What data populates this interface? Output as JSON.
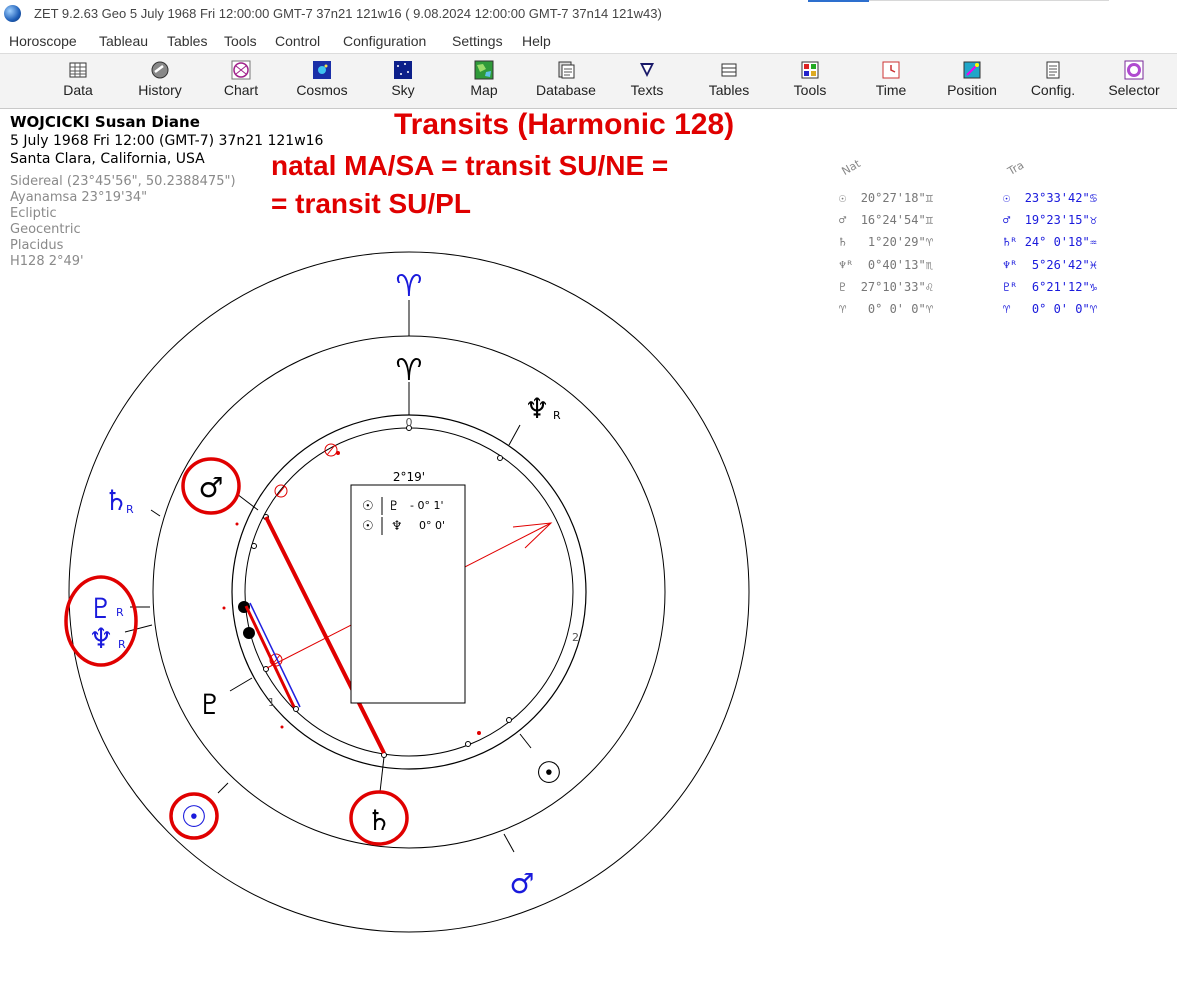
{
  "window": {
    "title": "ZET 9.2.63 Geo     5 July 1968  Fri  12:00:00 GMT-7 37n21  121w16  ( 9.08.2024  12:00:00 GMT-7 37n14 121w43)"
  },
  "menu": [
    "Horoscope",
    "Tableau",
    "Tables",
    "Tools",
    "Control",
    "Configuration",
    "Settings",
    "Help"
  ],
  "toolbar": [
    {
      "label": "Data",
      "icon": "data-grid-icon"
    },
    {
      "label": "History",
      "icon": "history-icon"
    },
    {
      "label": "Chart",
      "icon": "chart-wheel-icon"
    },
    {
      "label": "Cosmos",
      "icon": "cosmos-icon"
    },
    {
      "label": "Sky",
      "icon": "sky-icon"
    },
    {
      "label": "Map",
      "icon": "map-icon"
    },
    {
      "label": "Database",
      "icon": "database-icon"
    },
    {
      "label": "Texts",
      "icon": "texts-icon"
    },
    {
      "label": "Tables",
      "icon": "tables-icon"
    },
    {
      "label": "Tools",
      "icon": "tools-icon"
    },
    {
      "label": "Time",
      "icon": "time-icon"
    },
    {
      "label": "Position",
      "icon": "position-icon"
    },
    {
      "label": "Config.",
      "icon": "config-icon"
    },
    {
      "label": "Selector",
      "icon": "selector-icon"
    }
  ],
  "person": {
    "name": "WOJCICKI Susan Diane",
    "datetime": "5 July 1968  Fri  12:00 (GMT-7) 37n21  121w16",
    "place": "Santa Clara, California, USA",
    "settings": [
      "Sidereal (23°45'56\", 50.2388475\")",
      "Ayanamsa 23°19'34\"",
      "Ecliptic",
      "Geocentric",
      "Placidus",
      "H128   2°49'"
    ]
  },
  "annotation": {
    "title": "Transits (Harmonic 128)",
    "line1": "natal MA/SA = transit SU/NE =",
    "line2": "= transit SU/PL"
  },
  "positions": {
    "nat_header": "Nat",
    "tra_header": "Tra",
    "natal": [
      {
        "glyph": "☉",
        "text": "20°27'18\"",
        "sign": "♊"
      },
      {
        "glyph": "♂",
        "text": "16°24'54\"",
        "sign": "♊"
      },
      {
        "glyph": "♄",
        "text": " 1°20'29\"",
        "sign": "♈"
      },
      {
        "glyph": "♆ᴿ",
        "text": " 0°40'13\"",
        "sign": "♏"
      },
      {
        "glyph": "♇",
        "text": "27°10'33\"",
        "sign": "♌"
      },
      {
        "glyph": "♈",
        "text": " 0° 0' 0\"",
        "sign": "♈"
      }
    ],
    "transit": [
      {
        "glyph": "☉",
        "text": "23°33'42\"",
        "sign": "♋"
      },
      {
        "glyph": "♂",
        "text": "19°23'15\"",
        "sign": "♉"
      },
      {
        "glyph": "♄ᴿ",
        "text": "24° 0'18\"",
        "sign": "♒"
      },
      {
        "glyph": "♆ᴿ",
        "text": " 5°26'42\"",
        "sign": "♓"
      },
      {
        "glyph": "♇ᴿ",
        "text": " 6°21'12\"",
        "sign": "♑"
      },
      {
        "glyph": "♈",
        "text": " 0° 0' 0\"",
        "sign": "♈"
      }
    ]
  },
  "chart": {
    "center_label": "2°19'",
    "aspects": [
      {
        "glyph1": "☉",
        "glyph2": "♇",
        "text": "- 0° 1'"
      },
      {
        "glyph1": "☉",
        "glyph2": "♆",
        "text": "0° 0'"
      }
    ],
    "tick_0": "0",
    "tick_1": "1",
    "tick_2": "2",
    "natal_glyphs": {
      "aries": "♈",
      "neptune": "♆",
      "mars": "♂",
      "pluto": "♇",
      "sun": "☉",
      "saturn": "♄"
    },
    "transit_glyphs": {
      "aries": "♈",
      "saturn": "♄",
      "pluto": "♇",
      "neptune": "♆",
      "sun": "☉",
      "mars": "♂"
    },
    "retro": "R",
    "colors": {
      "natal": "#000000",
      "transit": "#1a1adc",
      "annotation": "#e00000"
    }
  }
}
